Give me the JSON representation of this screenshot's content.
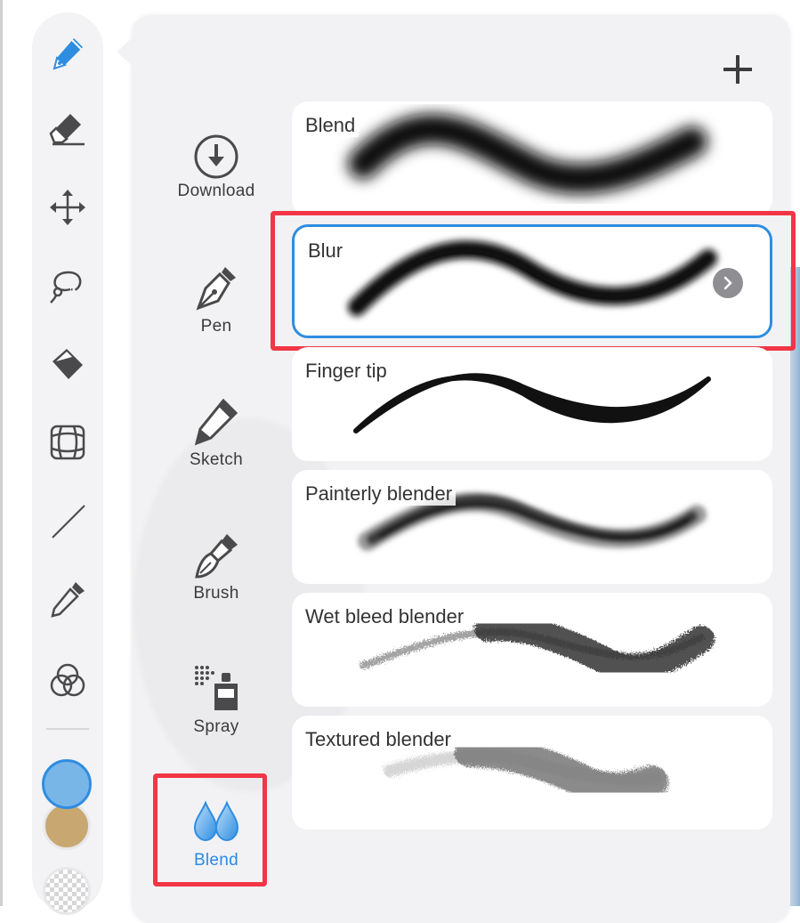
{
  "toolbar": {
    "tools": [
      {
        "name": "brush-tool",
        "icon": "brush-pen-icon",
        "active": true
      },
      {
        "name": "eraser-tool",
        "icon": "eraser-icon"
      },
      {
        "name": "move-tool",
        "icon": "move-arrows-icon"
      },
      {
        "name": "lasso-tool",
        "icon": "lasso-icon"
      },
      {
        "name": "fill-tool",
        "icon": "paint-bucket-icon"
      },
      {
        "name": "perspective-grid-tool",
        "icon": "perspective-grid-icon"
      },
      {
        "name": "line-tool",
        "icon": "line-icon"
      },
      {
        "name": "eyedropper-tool",
        "icon": "eyedropper-icon"
      },
      {
        "name": "color-mix-tool",
        "icon": "color-circles-icon"
      }
    ],
    "colors": {
      "primary": "#79b6e8",
      "secondary": "#c8a870"
    }
  },
  "panel": {
    "add_icon": "plus-icon",
    "categories": [
      {
        "label": "Download",
        "icon": "download-icon"
      },
      {
        "label": "Pen",
        "icon": "pen-nib-icon"
      },
      {
        "label": "Sketch",
        "icon": "pencil-icon"
      },
      {
        "label": "Brush",
        "icon": "paintbrush-icon"
      },
      {
        "label": "Spray",
        "icon": "spray-can-icon"
      },
      {
        "label": "Blend",
        "icon": "blend-drops-icon",
        "active": true
      }
    ],
    "brushes": [
      {
        "name": "Blend"
      },
      {
        "name": "Blur",
        "selected": true,
        "more_icon": "chevron-right-icon"
      },
      {
        "name": "Finger tip"
      },
      {
        "name": "Painterly blender"
      },
      {
        "name": "Wet bleed blender"
      },
      {
        "name": "Textured blender"
      }
    ]
  },
  "colors": {
    "accent": "#2f8de0",
    "highlight_box": "#f23646"
  }
}
